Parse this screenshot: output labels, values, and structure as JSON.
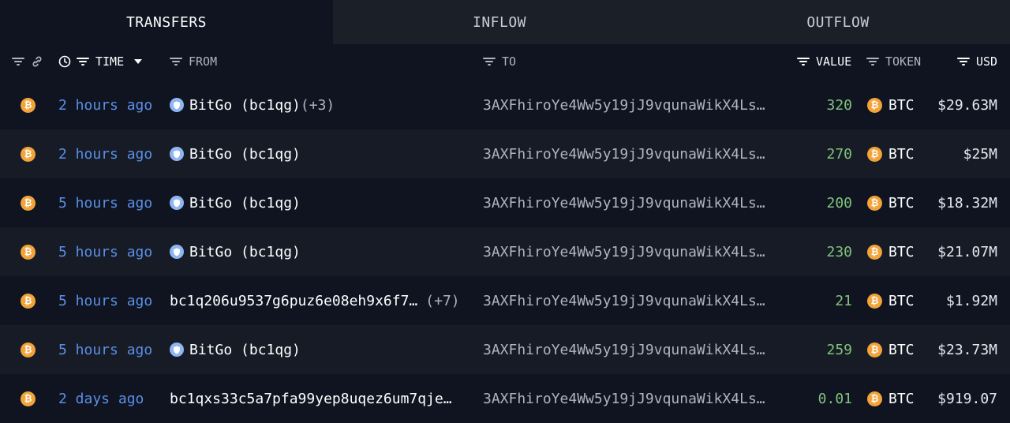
{
  "tabs": {
    "transfers": "TRANSFERS",
    "inflow": "INFLOW",
    "outflow": "OUTFLOW"
  },
  "columns": {
    "time": "TIME",
    "from": "FROM",
    "to": "TO",
    "value": "VALUE",
    "token": "TOKEN",
    "usd": "USD"
  },
  "icons": {
    "coin": "bitcoin-icon",
    "entity": "bitgo-shield-icon"
  },
  "colors": {
    "time_link": "#5c8fe6",
    "value_green": "#7fc47a",
    "btc_orange": "#f2a33a"
  },
  "rows": [
    {
      "time": "2 hours ago",
      "from": "BitGo (bc1qg)",
      "from_extra": "(+3)",
      "entity": true,
      "to": "3AXFhiroYe4Ww5y19jJ9vqunaWikX4Ls…",
      "value": "320",
      "token": "BTC",
      "usd": "$29.63M"
    },
    {
      "time": "2 hours ago",
      "from": "BitGo (bc1qg)",
      "from_extra": "",
      "entity": true,
      "to": "3AXFhiroYe4Ww5y19jJ9vqunaWikX4Ls…",
      "value": "270",
      "token": "BTC",
      "usd": "$25M"
    },
    {
      "time": "5 hours ago",
      "from": "BitGo (bc1qg)",
      "from_extra": "",
      "entity": true,
      "to": "3AXFhiroYe4Ww5y19jJ9vqunaWikX4Ls…",
      "value": "200",
      "token": "BTC",
      "usd": "$18.32M"
    },
    {
      "time": "5 hours ago",
      "from": "BitGo (bc1qg)",
      "from_extra": "",
      "entity": true,
      "to": "3AXFhiroYe4Ww5y19jJ9vqunaWikX4Ls…",
      "value": "230",
      "token": "BTC",
      "usd": "$21.07M"
    },
    {
      "time": "5 hours ago",
      "from": "bc1q206u9537g6puz6e08eh9x6f7…",
      "from_extra": "(+7)",
      "entity": false,
      "to": "3AXFhiroYe4Ww5y19jJ9vqunaWikX4Ls…",
      "value": "21",
      "token": "BTC",
      "usd": "$1.92M"
    },
    {
      "time": "5 hours ago",
      "from": "BitGo (bc1qg)",
      "from_extra": "",
      "entity": true,
      "to": "3AXFhiroYe4Ww5y19jJ9vqunaWikX4Ls…",
      "value": "259",
      "token": "BTC",
      "usd": "$23.73M"
    },
    {
      "time": "2 days ago",
      "from": "bc1qxs33c5a7pfa99yep8uqez6um7qje…",
      "from_extra": "",
      "entity": false,
      "to": "3AXFhiroYe4Ww5y19jJ9vqunaWikX4Ls…",
      "value": "0.01",
      "token": "BTC",
      "usd": "$919.07"
    }
  ]
}
